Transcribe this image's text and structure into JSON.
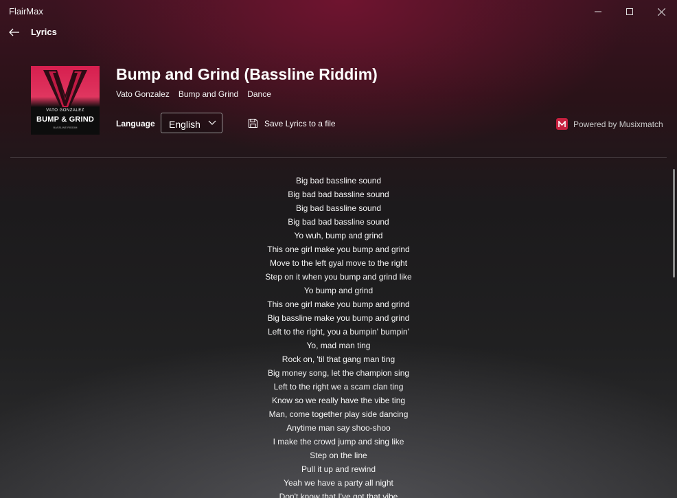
{
  "window": {
    "title": "FlairMax"
  },
  "nav": {
    "title": "Lyrics"
  },
  "album": {
    "artist_text": "VATO GONZALEZ",
    "title_text": "BUMP & GRIND",
    "sub_text": "BASSLINE RIDDIM"
  },
  "song": {
    "title": "Bump and Grind (Bassline Riddim)",
    "artist": "Vato Gonzalez",
    "album": "Bump and Grind",
    "genre": "Dance"
  },
  "controls": {
    "language_label": "Language",
    "language_value": "English",
    "save_label": "Save Lyrics to a file",
    "powered_by": "Powered by Musixmatch"
  },
  "colors": {
    "accent": "#c7203f",
    "album_red": "#d61f4f"
  },
  "icons": {
    "back": "back-arrow-icon",
    "minimize": "minimize-icon",
    "maximize": "maximize-icon",
    "close": "close-icon",
    "chevron": "chevron-down-icon",
    "save": "save-icon",
    "musixmatch": "musixmatch-logo-icon"
  },
  "lyrics": [
    "Big bad bassline sound",
    "Big bad bad bassline sound",
    "Big bad bassline sound",
    "Big bad bad bassline sound",
    "Yo wuh, bump and grind",
    "This one girl make you bump and grind",
    "Move to the left gyal move to the right",
    "Step on it when you bump and grind like",
    "Yo bump and grind",
    "This one girl make you bump and grind",
    "Big bassline make you bump and grind",
    "Left to the right, you a bumpin' bumpin'",
    "Yo, mad man ting",
    "Rock on, 'til that gang man ting",
    "Big money song, let the champion sing",
    "Left to the right we a scam clan ting",
    "Know so we really have the vibe ting",
    "Man, come together play side dancing",
    "Anytime man say shoo-shoo",
    "I make the crowd jump and sing like",
    "Step on the line",
    "Pull it up and rewind",
    "Yeah we have a party all night",
    "Don't know that I've got that vibe"
  ]
}
